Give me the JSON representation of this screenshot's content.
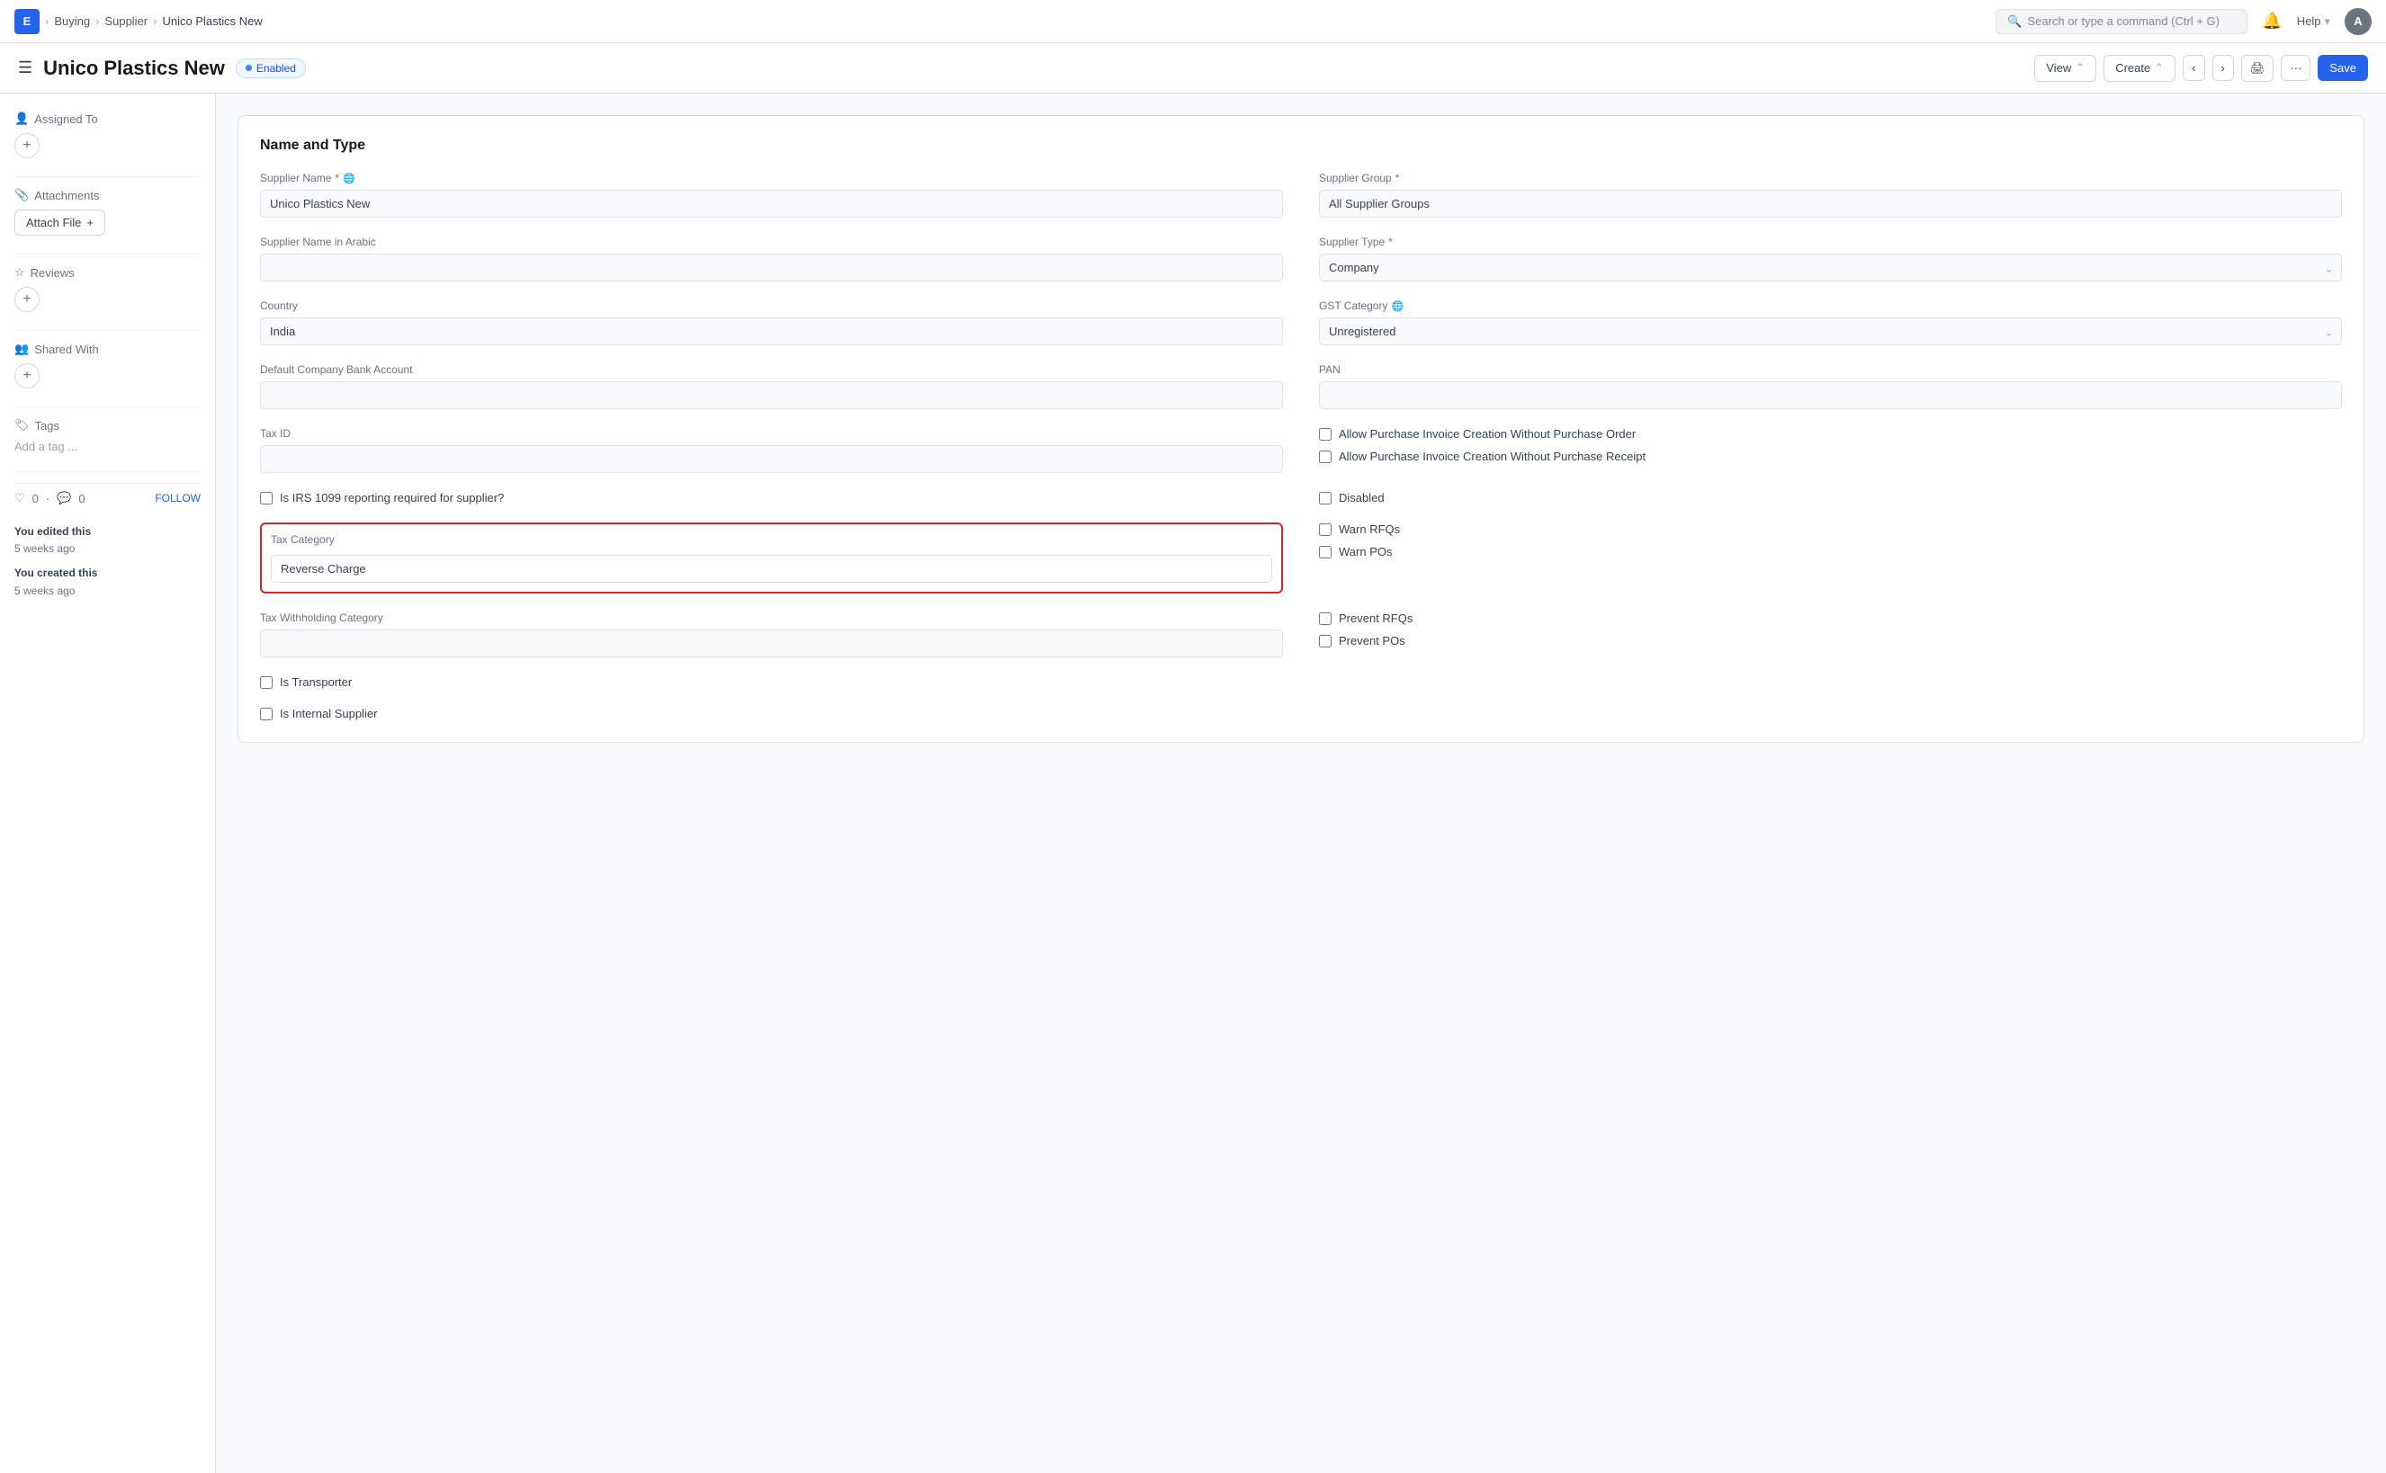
{
  "topnav": {
    "app_icon": "E",
    "breadcrumbs": [
      "Buying",
      "Supplier",
      "Unico Plastics New"
    ],
    "search_placeholder": "Search or type a command (Ctrl + G)",
    "help_label": "Help",
    "avatar_label": "A"
  },
  "header": {
    "title": "Unico Plastics New",
    "status": "Enabled",
    "menu_icon": "☰",
    "buttons": {
      "view": "View",
      "create": "Create",
      "save": "Save"
    }
  },
  "sidebar": {
    "assigned_to_label": "Assigned To",
    "attachments_label": "Attachments",
    "attach_file_label": "Attach File",
    "reviews_label": "Reviews",
    "shared_with_label": "Shared With",
    "tags_label": "Tags",
    "add_tag_placeholder": "Add a tag ...",
    "likes_count": "0",
    "comments_count": "0",
    "follow_label": "FOLLOW",
    "activity": [
      {
        "action": "You edited this",
        "when": "5 weeks ago"
      },
      {
        "action": "You created this",
        "when": "5 weeks ago"
      }
    ]
  },
  "form": {
    "section_title": "Name and Type",
    "fields": {
      "supplier_name_label": "Supplier Name",
      "supplier_name_value": "Unico Plastics New",
      "supplier_name_arabic_label": "Supplier Name in Arabic",
      "supplier_name_arabic_value": "",
      "country_label": "Country",
      "country_value": "India",
      "default_bank_label": "Default Company Bank Account",
      "default_bank_value": "",
      "tax_id_label": "Tax ID",
      "tax_id_value": "",
      "supplier_group_label": "Supplier Group",
      "supplier_group_value": "All Supplier Groups",
      "supplier_type_label": "Supplier Type",
      "supplier_type_value": "Company",
      "gst_category_label": "GST Category",
      "gst_category_value": "Unregistered",
      "pan_label": "PAN",
      "pan_value": "",
      "tax_category_label": "Tax Category",
      "tax_category_value": "Reverse Charge",
      "tax_withholding_label": "Tax Withholding Category",
      "tax_withholding_value": ""
    },
    "checkboxes": {
      "irs_1099": "Is IRS 1099 reporting required for supplier?",
      "allow_invoice_no_po": "Allow Purchase Invoice Creation Without Purchase Order",
      "allow_invoice_no_receipt": "Allow Purchase Invoice Creation Without Purchase Receipt",
      "disabled": "Disabled",
      "warn_rfqs": "Warn RFQs",
      "warn_pos": "Warn POs",
      "prevent_rfqs": "Prevent RFQs",
      "prevent_pos": "Prevent POs",
      "is_transporter": "Is Transporter",
      "is_internal_supplier": "Is Internal Supplier"
    }
  }
}
